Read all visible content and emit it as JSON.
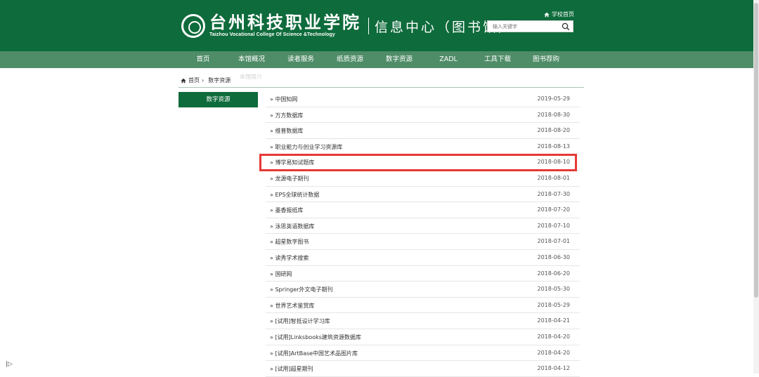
{
  "header": {
    "logo_cn": "台州科技职业学院",
    "logo_en": "Taizhou Vocational College Of Science &Technology",
    "subtitle": "信息中心（图书馆）",
    "home_link": "学校首页",
    "search_placeholder": "输入关键字"
  },
  "nav": [
    "首页",
    "本馆概况",
    "读者服务",
    "纸质资源",
    "数字资源",
    "ZADL",
    "工具下载",
    "图书荐购"
  ],
  "breadcrumb": {
    "home": "首页",
    "sep": "›",
    "current": "数字资源",
    "ghost": "本馆简介"
  },
  "sidebar": {
    "title": "数字资源"
  },
  "list": [
    {
      "title": "» 中国知网",
      "date": "2019-05-29"
    },
    {
      "title": "» 万方数据库",
      "date": "2018-08-30"
    },
    {
      "title": "» 维普数据库",
      "date": "2018-08-20"
    },
    {
      "title": "» 职业能力与创业学习资源库",
      "date": "2018-08-13"
    },
    {
      "title": "» 博学易知试题库",
      "date": "2018-08-10"
    },
    {
      "title": "» 龙源电子期刊",
      "date": "2018-08-01"
    },
    {
      "title": "» EPS全球统计数据",
      "date": "2018-07-30"
    },
    {
      "title": "» 墨香报纸库",
      "date": "2018-07-20"
    },
    {
      "title": "» 泳思英语数据库",
      "date": "2018-07-10"
    },
    {
      "title": "» 超星数字图书",
      "date": "2018-07-01"
    },
    {
      "title": "» 读秀学术搜索",
      "date": "2018-06-30"
    },
    {
      "title": "» 国研网",
      "date": "2018-06-20"
    },
    {
      "title": "» Springer外文电子期刊",
      "date": "2018-05-30"
    },
    {
      "title": "» 世界艺术鉴赏库",
      "date": "2018-05-29"
    },
    {
      "title": "» [试用]智抵设计学习库",
      "date": "2018-04-21"
    },
    {
      "title": "» [试用]Linksbooks建筑资源数据库",
      "date": "2018-04-20"
    },
    {
      "title": "» [试用]ArtBase中国艺术品图片库",
      "date": "2018-04-20"
    },
    {
      "title": "» [试用]超星期刊",
      "date": "2018-04-12"
    }
  ],
  "colors": {
    "primary": "#0e6b3b",
    "nav": "#4f8c68",
    "highlight": "#e53935"
  },
  "icons": [
    "seal-logo",
    "home-icon",
    "search-icon",
    "sidebar-toggle-icon"
  ]
}
